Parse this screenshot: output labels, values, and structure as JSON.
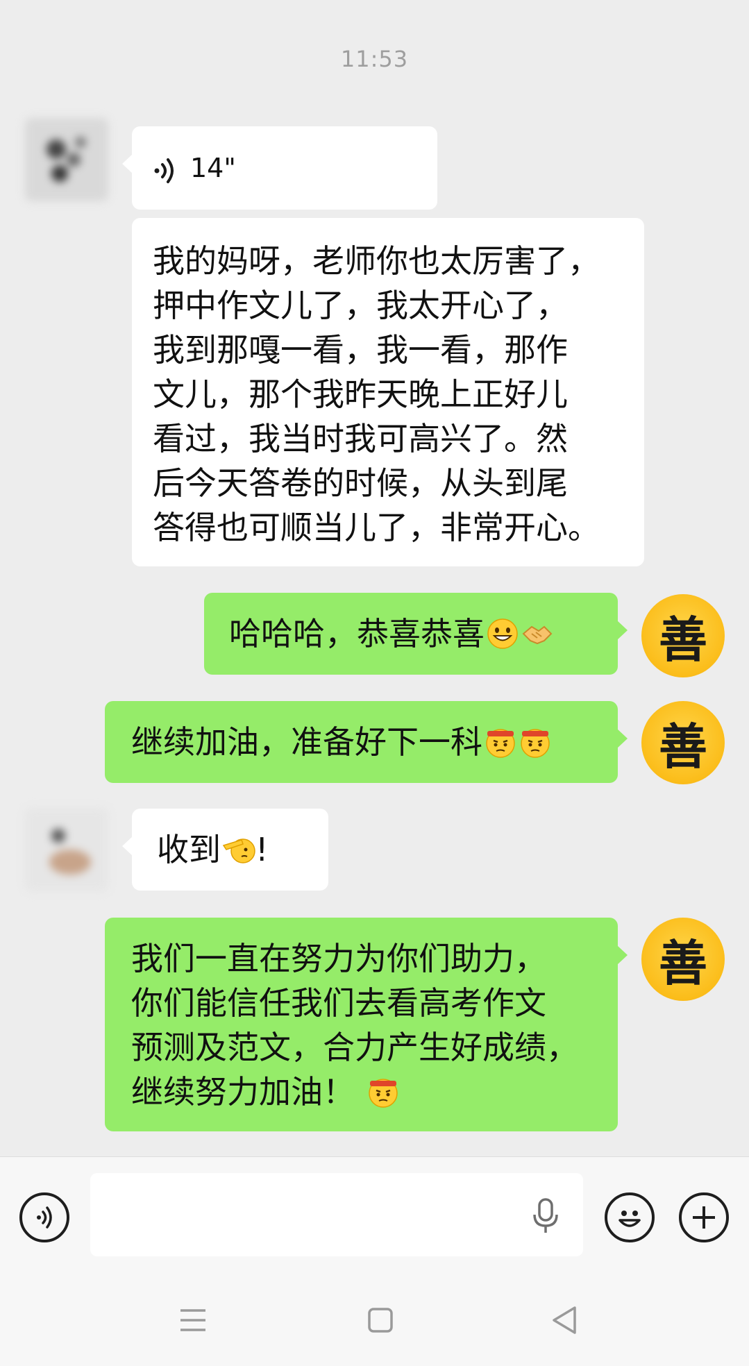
{
  "chat": {
    "timestamp": "11:53",
    "messages": [
      {
        "side": "left",
        "type": "voice",
        "duration": "14\""
      },
      {
        "side": "left",
        "type": "text",
        "lines": [
          "我的妈呀，老师你也太厉害了，",
          "押中作文儿了，我太开心了，",
          "我到那嘎一看，我一看，那作",
          "文儿，那个我昨天晚上正好儿",
          "看过，我当时我可高兴了。然",
          "后今天答卷的时候，从头到尾",
          "答得也可顺当儿了，非常开心。"
        ]
      },
      {
        "side": "right",
        "type": "text",
        "text": "哈哈哈，恭喜恭喜",
        "emojis": [
          "grin-emoji",
          "handshake-emoji"
        ]
      },
      {
        "side": "right",
        "type": "text",
        "text": "继续加油，准备好下一科",
        "emojis": [
          "determined-emoji",
          "determined-emoji"
        ]
      },
      {
        "side": "left",
        "type": "text",
        "text": "收到",
        "emojis": [
          "salute-emoji"
        ],
        "suffix": "!"
      },
      {
        "side": "right",
        "type": "text",
        "lines": [
          "我们一直在努力为你们助力，",
          "你们能信任我们去看高考作文",
          "预测及范文，合力产生好成绩，",
          "继续努力加油！"
        ],
        "emojis": [
          "determined-emoji"
        ]
      }
    ],
    "self_avatar_char": "善"
  },
  "input_bar": {
    "voice_toggle_icon": "voice-toggle-icon",
    "mic_icon": "microphone-icon",
    "emoji_icon": "emoji-face-icon",
    "plus_icon": "plus-circle-icon",
    "value": ""
  },
  "nav_bar": {
    "icons": [
      "menu-lines-icon",
      "home-square-icon",
      "back-triangle-icon"
    ]
  },
  "colors": {
    "background": "#ededed",
    "incoming_bubble": "#ffffff",
    "outgoing_bubble": "#95ec69",
    "timestamp": "#9e9e9e"
  }
}
